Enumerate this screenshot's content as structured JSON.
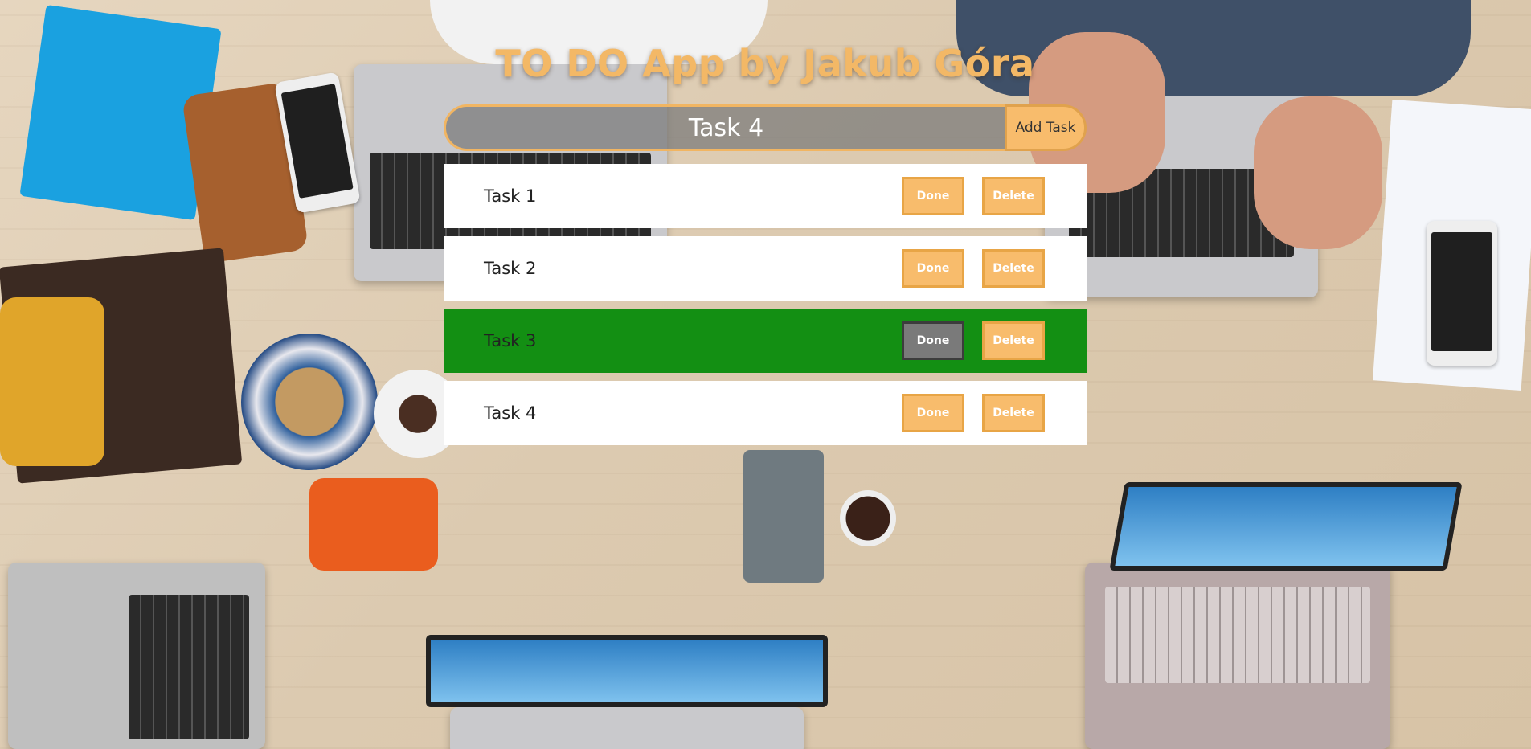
{
  "app": {
    "title": "TO DO App by Jakub Góra"
  },
  "task_input": {
    "value": "Task 4",
    "add_button_label": "Add Task"
  },
  "tasks": [
    {
      "label": "Task 1",
      "done_label": "Done",
      "delete_label": "Delete",
      "completed": false
    },
    {
      "label": "Task 2",
      "done_label": "Done",
      "delete_label": "Delete",
      "completed": false
    },
    {
      "label": "Task 3",
      "done_label": "Done",
      "delete_label": "Delete",
      "completed": true
    },
    {
      "label": "Task 4",
      "done_label": "Done",
      "delete_label": "Delete",
      "completed": false
    }
  ],
  "colors": {
    "accent": "#f8bc6c",
    "completed_row": "#138f13",
    "done_button_active": "#7a7a7a"
  },
  "background": {
    "description_icon": "desk-workspace-photo"
  }
}
